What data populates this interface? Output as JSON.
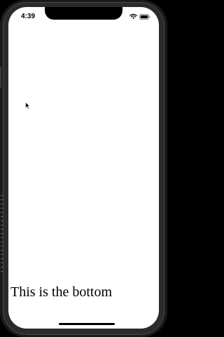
{
  "status_bar": {
    "time": "4:39",
    "icons": [
      "wifi-icon",
      "battery-icon"
    ]
  },
  "content": {
    "bottom_text": "This is the bottom"
  },
  "colors": {
    "background": "#ffffff",
    "text": "#000000",
    "device_frame": "#2b2b2b"
  }
}
